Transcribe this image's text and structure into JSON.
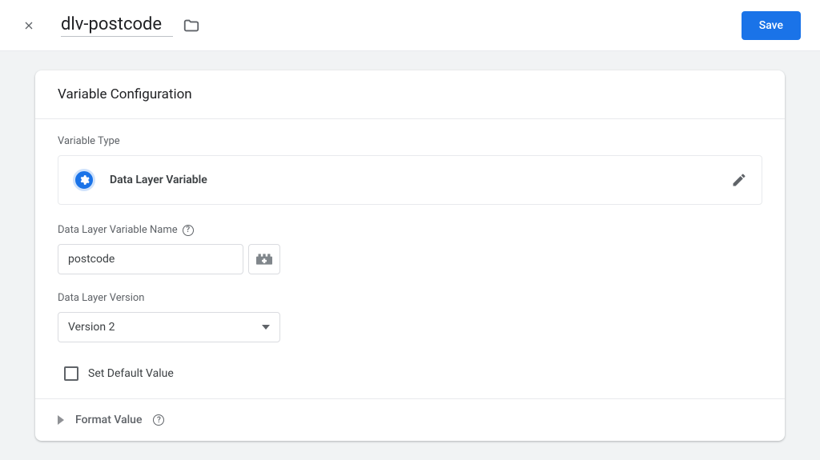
{
  "header": {
    "title": "dlv-postcode",
    "save_label": "Save"
  },
  "card": {
    "title": "Variable Configuration",
    "variable_type_label": "Variable Type",
    "variable_type": "Data Layer Variable",
    "name_label": "Data Layer Variable Name",
    "name_value": "postcode",
    "version_label": "Data Layer Version",
    "version_value": "Version 2",
    "default_value_label": "Set Default Value",
    "format_value_label": "Format Value"
  }
}
